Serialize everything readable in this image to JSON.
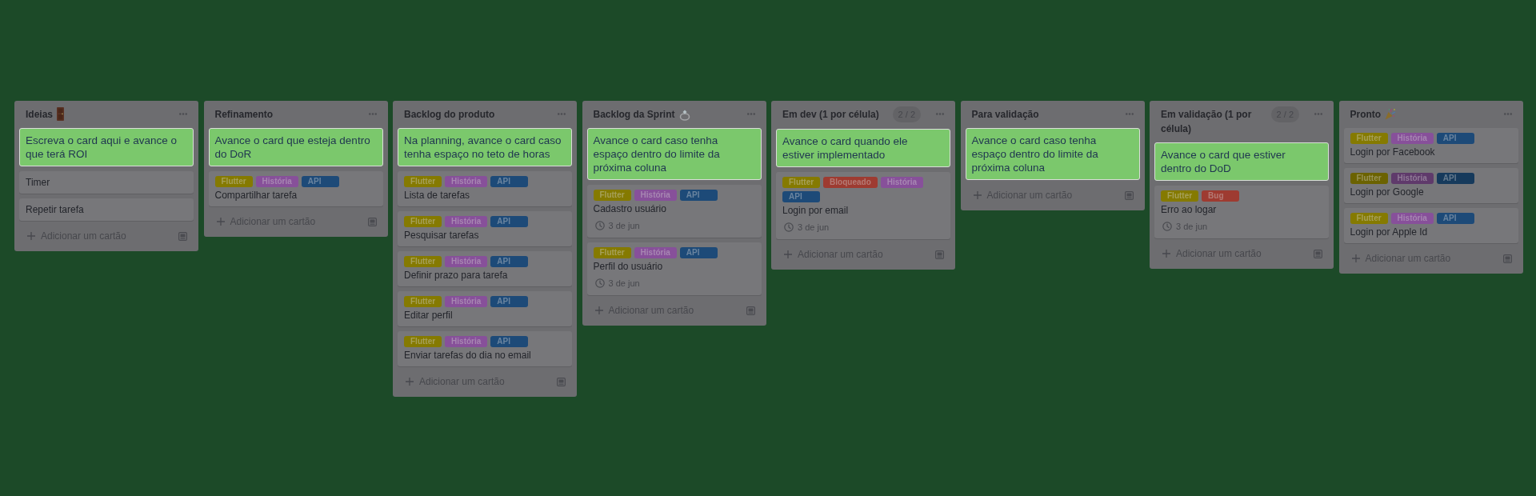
{
  "board": {
    "lists": [
      {
        "title": "Ideias",
        "cards": [
          {
            "kind": "note",
            "text": "Escreva o card aqui e avance o que terá ROI"
          },
          {
            "kind": "task",
            "title": "Timer"
          },
          {
            "kind": "task",
            "title": "Repetir tarefa"
          }
        ],
        "add_card": "Adicionar um cartão"
      },
      {
        "title": "Refinamento",
        "cards": [
          {
            "kind": "note",
            "text": "Avance o card que esteja dentro do DoR"
          },
          {
            "kind": "task",
            "labels": [
              {
                "text": "Flutter",
                "color": "#857a00"
              },
              {
                "text": "História",
                "color": "#87509a"
              },
              {
                "text": "API",
                "color": "#1d4a78"
              }
            ],
            "title": "Compartilhar tarefa"
          }
        ],
        "add_card": "Adicionar um cartão"
      },
      {
        "title": "Backlog do produto",
        "cards": [
          {
            "kind": "note",
            "text": "Na planning, avance o card caso tenha espaço no teto de horas"
          },
          {
            "kind": "task",
            "labels": [
              {
                "text": "Flutter",
                "color": "#857a00"
              },
              {
                "text": "História",
                "color": "#87509a"
              },
              {
                "text": "API",
                "color": "#1d4a78"
              }
            ],
            "title": "Lista de tarefas"
          },
          {
            "kind": "task",
            "labels": [
              {
                "text": "Flutter",
                "color": "#857a00"
              },
              {
                "text": "História",
                "color": "#87509a"
              },
              {
                "text": "API",
                "color": "#1d4a78"
              }
            ],
            "title": "Pesquisar tarefas"
          },
          {
            "kind": "task",
            "labels": [
              {
                "text": "Flutter",
                "color": "#857a00"
              },
              {
                "text": "História",
                "color": "#87509a"
              },
              {
                "text": "API",
                "color": "#1d4a78"
              }
            ],
            "title": "Definir prazo para tarefa"
          },
          {
            "kind": "task",
            "labels": [
              {
                "text": "Flutter",
                "color": "#857a00"
              },
              {
                "text": "História",
                "color": "#87509a"
              },
              {
                "text": "API",
                "color": "#1d4a78"
              }
            ],
            "title": "Editar perfil"
          },
          {
            "kind": "task",
            "labels": [
              {
                "text": "Flutter",
                "color": "#857a00"
              },
              {
                "text": "História",
                "color": "#87509a"
              },
              {
                "text": "API",
                "color": "#1d4a78"
              }
            ],
            "title": "Enviar tarefas do dia no email"
          }
        ],
        "add_card": "Adicionar um cartão"
      },
      {
        "title": "Backlog da Sprint",
        "cards": [
          {
            "kind": "note",
            "text": "Avance o card caso tenha espaço dentro do limite da próxima coluna"
          },
          {
            "kind": "task",
            "labels": [
              {
                "text": "Flutter",
                "color": "#857a00"
              },
              {
                "text": "História",
                "color": "#87509a"
              },
              {
                "text": "API",
                "color": "#1d4a78"
              }
            ],
            "title": "Cadastro usuário",
            "due": "3 de jun"
          },
          {
            "kind": "task",
            "labels": [
              {
                "text": "Flutter",
                "color": "#857a00"
              },
              {
                "text": "História",
                "color": "#87509a"
              },
              {
                "text": "API",
                "color": "#1d4a78"
              }
            ],
            "title": "Perfil do usuário",
            "due": "3 de jun"
          }
        ],
        "add_card": "Adicionar um cartão"
      },
      {
        "title": "Em dev (1 por célula)",
        "limit": "2 / 2",
        "cards": [
          {
            "kind": "note",
            "text": "Avance o card quando ele estiver implementado"
          },
          {
            "kind": "task",
            "labels": [
              {
                "text": "Flutter",
                "color": "#857a00"
              },
              {
                "text": "Bloqueado",
                "color": "#9e3b31"
              },
              {
                "text": "História",
                "color": "#87509a"
              },
              {
                "text": "API",
                "color": "#1d4a78"
              }
            ],
            "title": "Login por email",
            "due": "3 de jun"
          }
        ],
        "add_card": "Adicionar um cartão"
      },
      {
        "title": "Para validação",
        "cards": [
          {
            "kind": "note",
            "text": "Avance o card caso tenha espaço dentro do limite da próxima coluna"
          }
        ],
        "add_card": "Adicionar um cartão"
      },
      {
        "title": "Em validação (1 por célula)",
        "limit": "2 / 2",
        "cards": [
          {
            "kind": "note",
            "text": "Avance o card que estiver dentro do DoD"
          },
          {
            "kind": "task",
            "labels": [
              {
                "text": "Flutter",
                "color": "#857a00"
              },
              {
                "text": "Bug",
                "color": "#9e3b31"
              }
            ],
            "title": "Erro ao logar",
            "due": "3 de jun"
          }
        ],
        "add_card": "Adicionar um cartão"
      },
      {
        "title": "Pronto",
        "cards": [
          {
            "kind": "task",
            "labels": [
              {
                "text": "Flutter",
                "color": "#857a00"
              },
              {
                "text": "História",
                "color": "#87509a"
              },
              {
                "text": "API",
                "color": "#1d4a78"
              }
            ],
            "title": "Login por Facebook"
          },
          {
            "kind": "task",
            "labels": [
              {
                "text": "Flutter",
                "color": "#6b6200"
              },
              {
                "text": "História",
                "color": "#5f3a6b"
              },
              {
                "text": "API",
                "color": "#163a5c"
              }
            ],
            "title": "Login por Google"
          },
          {
            "kind": "task",
            "labels": [
              {
                "text": "Flutter",
                "color": "#857a00"
              },
              {
                "text": "História",
                "color": "#87509a"
              },
              {
                "text": "API",
                "color": "#1d4a78"
              }
            ],
            "title": "Login por Apple Id"
          }
        ],
        "add_card": "Adicionar um cartão"
      }
    ]
  }
}
